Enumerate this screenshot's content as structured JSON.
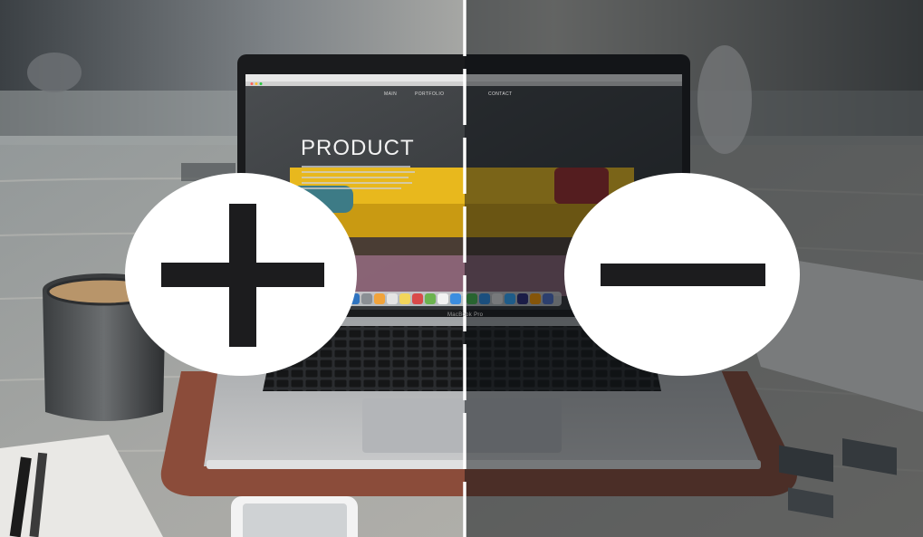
{
  "scene": {
    "screen": {
      "headline": "PRODUCT",
      "nav_items": [
        "MAIN",
        "PORTFOLIO",
        "CONTACT"
      ]
    },
    "laptop_label": "MacBook Pro",
    "symbols": {
      "left": "plus",
      "right": "minus"
    },
    "colors": {
      "symbol_fill": "#ffffff",
      "symbol_cutout": "#1c1c1e",
      "sofa_yellow": "#e8b81d",
      "divider": "#ffffff",
      "right_half_tint": "#0c1014"
    }
  }
}
